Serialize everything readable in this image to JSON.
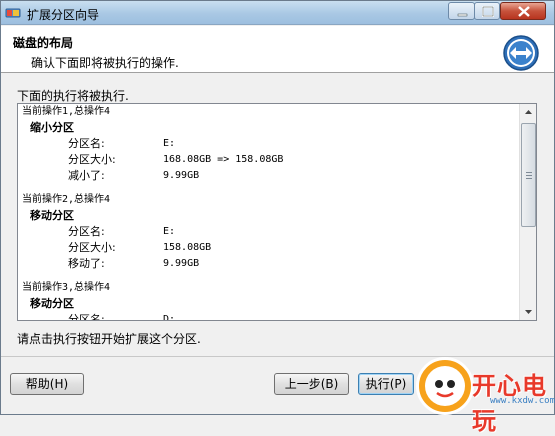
{
  "window": {
    "title": "扩展分区向导"
  },
  "header": {
    "title": "磁盘的布局",
    "subtitle": "确认下面即将被执行的操作."
  },
  "section_label": "下面的执行将被执行.",
  "operations": [
    {
      "head": "当前操作1,总操作4",
      "title": "缩小分区",
      "rows": [
        {
          "key": "分区名:",
          "value": "E:"
        },
        {
          "key": "分区大小:",
          "value": "168.08GB => 158.08GB"
        },
        {
          "key": "减小了:",
          "value": "9.99GB"
        }
      ]
    },
    {
      "head": "当前操作2,总操作4",
      "title": "移动分区",
      "rows": [
        {
          "key": "分区名:",
          "value": "E:"
        },
        {
          "key": "分区大小:",
          "value": "158.08GB"
        },
        {
          "key": "移动了:",
          "value": "9.99GB"
        }
      ]
    },
    {
      "head": "当前操作3,总操作4",
      "title": "移动分区",
      "rows": [
        {
          "key": "分区名:",
          "value": "D:"
        }
      ]
    }
  ],
  "hint": "请点击执行按钮开始扩展这个分区.",
  "buttons": {
    "help": "帮助(H)",
    "back": "上一步(B)",
    "execute": "执行(P)"
  },
  "watermark": {
    "brand": "开心电玩",
    "url": "www.kxdw.com"
  },
  "colors": {
    "titlebar": "#a9c8e4",
    "close": "#c7533c",
    "accent": "#3c7fb1",
    "watermark_red": "#e8392a",
    "watermark_orange": "#f7a21b"
  }
}
